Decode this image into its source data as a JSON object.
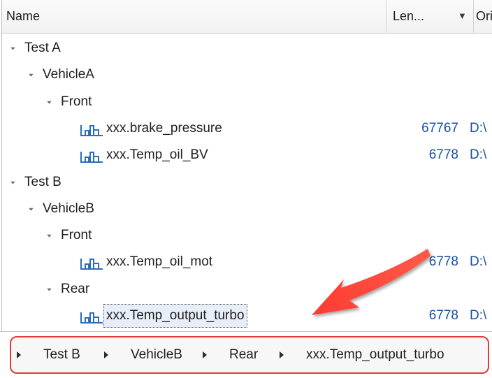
{
  "header": {
    "name_label": "Name",
    "length_label": "Len...",
    "sort_glyph": "▼",
    "origin_label": "Ori"
  },
  "tree": [
    {
      "label": "Test A",
      "level": 0,
      "type": "group",
      "expanded": true
    },
    {
      "label": "VehicleA",
      "level": 1,
      "type": "group",
      "expanded": true
    },
    {
      "label": "Front",
      "level": 2,
      "type": "group",
      "expanded": true
    },
    {
      "label": "xxx.brake_pressure",
      "level": 3,
      "type": "channel",
      "length": "67767",
      "origin": "D:\\"
    },
    {
      "label": "xxx.Temp_oil_BV",
      "level": 3,
      "type": "channel",
      "length": "6778",
      "origin": "D:\\"
    },
    {
      "label": "Test B",
      "level": 0,
      "type": "group",
      "expanded": true
    },
    {
      "label": "VehicleB",
      "level": 1,
      "type": "group",
      "expanded": true
    },
    {
      "label": "Front",
      "level": 2,
      "type": "group",
      "expanded": true
    },
    {
      "label": "xxx.Temp_oil_mot",
      "level": 3,
      "type": "channel",
      "length": "6778",
      "origin": "D:\\"
    },
    {
      "label": "Rear",
      "level": 2,
      "type": "group",
      "expanded": true
    },
    {
      "label": "xxx.Temp_output_turbo",
      "level": 3,
      "type": "channel",
      "length": "6778",
      "origin": "D:\\",
      "selected": true
    }
  ],
  "breadcrumb": [
    "Test B",
    "VehicleB",
    "Rear",
    "xxx.Temp_output_turbo"
  ],
  "colors": {
    "annotation": "#e53935",
    "value_text": "#1a4fa0",
    "icon": "#2a6ebd",
    "selection": "#e8eef8"
  },
  "icons": {
    "expander": "expand-triangle-icon",
    "channel": "bar-chart-icon",
    "breadcrumb_separator": "chevron-right-icon"
  }
}
